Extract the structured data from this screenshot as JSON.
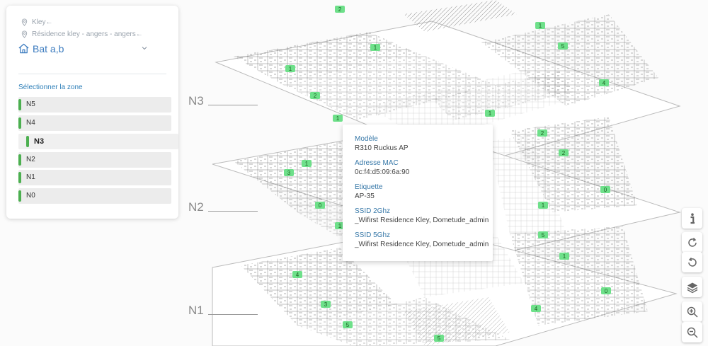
{
  "breadcrumb": {
    "site": "Kley←",
    "residence": "Résidence kley - angers - angers←"
  },
  "building": {
    "title": "Bat a,b"
  },
  "zones": {
    "title": "Sélectionner la zone",
    "items": [
      "N5",
      "N4",
      "N3",
      "N2",
      "N1",
      "N0"
    ],
    "active": "N3"
  },
  "floor_labels": [
    "N3",
    "N2",
    "N1"
  ],
  "tooltip": {
    "fields": [
      {
        "key": "Modèle",
        "value": "R310 Ruckus AP"
      },
      {
        "key": "Adresse MAC",
        "value": "0c:f4:d5:09:6a:90"
      },
      {
        "key": "Etiquette",
        "value": "AP-35"
      },
      {
        "key": "SSID 2Ghz",
        "value": "_Wifirst Residence Kley, Dometude_admin"
      },
      {
        "key": "SSID 5Ghz",
        "value": "_Wifirst Residence Kley, Dometude_admin"
      }
    ]
  },
  "ap_markers": [
    "2",
    "1",
    "1",
    "2",
    "1",
    "1",
    "5",
    "4",
    "1",
    "2",
    "2",
    "0",
    "3",
    "1",
    "0",
    "1",
    "1",
    "5",
    "1",
    "0",
    "4",
    "3",
    "4",
    "5",
    "5"
  ],
  "toolbar": {
    "icons": [
      "info-icon",
      "rotate-cw-icon",
      "rotate-ccw-icon",
      "layers-icon",
      "zoom-in-icon",
      "zoom-out-icon"
    ]
  },
  "colors": {
    "accent_blue": "#3b7bbf",
    "zone_green": "#4caf50",
    "ap_marker_green": "#6ee08a"
  }
}
